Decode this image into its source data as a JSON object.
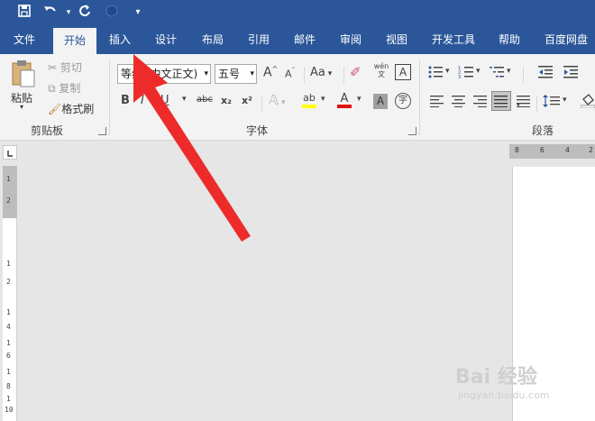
{
  "colors": {
    "ribbon_blue": "#2b579a",
    "arrow": "#ee2b2b"
  },
  "qat": [
    {
      "name": "save-icon",
      "glyph": "💾"
    },
    {
      "name": "undo-icon",
      "glyph": "↶"
    },
    {
      "name": "redo-icon",
      "glyph": "↻"
    },
    {
      "name": "touch-mode-icon",
      "glyph": "◯"
    },
    {
      "name": "customize-qat-icon",
      "glyph": "▾"
    }
  ],
  "tabs": [
    "文件",
    "开始",
    "插入",
    "设计",
    "布局",
    "引用",
    "邮件",
    "审阅",
    "视图",
    "开发工具",
    "帮助",
    "百度网盘"
  ],
  "active_tab": "开始",
  "clipboard": {
    "paste": "粘贴",
    "cut": "剪切",
    "copy": "复制",
    "format_painter": "格式刷",
    "group": "剪贴板"
  },
  "font": {
    "name": "等线 (中文正文)",
    "size": "五号",
    "group": "字体",
    "buttons": {
      "grow": "A",
      "shrink": "A",
      "case": "Aa",
      "bold": "B",
      "italic": "I",
      "underline": "U",
      "strike": "abc",
      "subscript": "x₂",
      "superscript": "x²",
      "phonetic": "wén 文",
      "char_border": "A",
      "highlight": "ab",
      "font_color": "A",
      "char_shading": "A",
      "enclose": "字"
    }
  },
  "paragraph": {
    "group": "段落"
  },
  "ruler": {
    "h_numbers": [
      "8",
      "6",
      "4",
      "2"
    ],
    "v_numbers": [
      "1",
      "2",
      "1",
      "2",
      "1",
      "4",
      "1",
      "6",
      "1",
      "8",
      "1",
      "10"
    ]
  },
  "watermark": {
    "text": "Bai 经验",
    "sub": "jingyan.baidu.com"
  }
}
